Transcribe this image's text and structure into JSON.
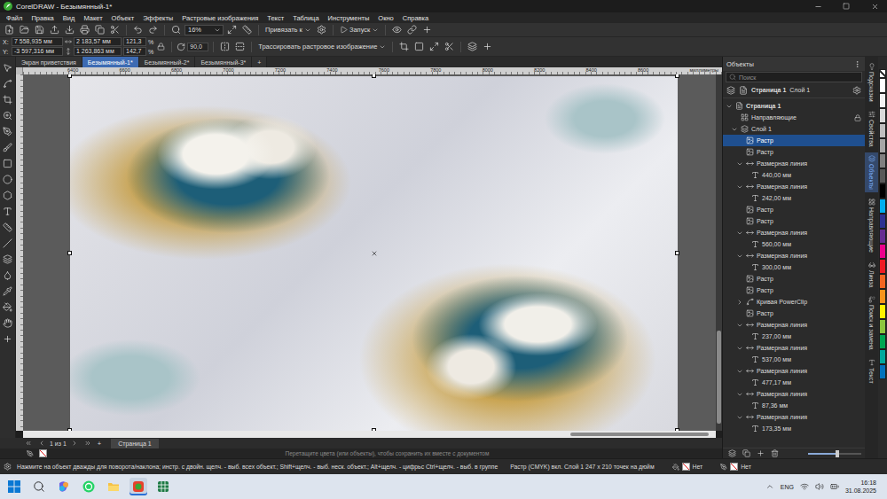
{
  "window": {
    "title": "CorelDRAW - Безымянный-1*"
  },
  "menu": [
    "Файл",
    "Правка",
    "Вид",
    "Макет",
    "Объект",
    "Эффекты",
    "Растровые изображения",
    "Текст",
    "Таблица",
    "Инструменты",
    "Окно",
    "Справка"
  ],
  "standard_toolbar": {
    "zoom": "16%",
    "snap": "Привязать к",
    "launch": "Запуск"
  },
  "property_bar": {
    "position": [
      {
        "label": "X:",
        "value": "7 558,935 мм"
      },
      {
        "label": "Y:",
        "value": "-3 597,316 мм"
      }
    ],
    "size": [
      "2 183,57 мм",
      "1 263,863 мм"
    ],
    "scale": [
      {
        "value": "121,3",
        "unit": "%"
      },
      {
        "value": "142,7",
        "unit": "%"
      }
    ],
    "rotation": "90,0",
    "trace": "Трассировать растровое изображение"
  },
  "document_tabs": [
    {
      "label": "Экран приветствия",
      "selected": false
    },
    {
      "label": "Безымянный-1*",
      "selected": true
    },
    {
      "label": "Безымянный-2*",
      "selected": false
    },
    {
      "label": "Безымянный-3*",
      "selected": false
    }
  ],
  "add_tab": "+",
  "ruler": {
    "labels": [
      "6400",
      "6600",
      "6800",
      "7000",
      "7200",
      "7400",
      "7600",
      "7800",
      "8000",
      "8200",
      "8400",
      "8600"
    ],
    "unit": "миллиметры"
  },
  "canvas": {
    "image_selected": true,
    "scroll_h": {
      "start": 0.79,
      "size": 0.2
    },
    "scroll_v": {
      "start": 0.72,
      "size": 0.26
    }
  },
  "page_nav": {
    "count": "1 из 1",
    "add_page": "+",
    "pages": [
      {
        "label": "Страница 1",
        "selected": true
      }
    ]
  },
  "hint": "Перетащите цвета (или объекты), чтобы сохранить их вместе с документом",
  "objects_docker": {
    "title": "Объекты",
    "search_placeholder": "Поиск",
    "page": "Страница 1",
    "layer": "Слой 1",
    "thumbnail_size": {
      "level": 0.55
    },
    "tree": [
      {
        "label": "Страница 1",
        "kind": "page",
        "depth": 0,
        "expandable": true,
        "expanded": true,
        "selected": false,
        "locked": false
      },
      {
        "label": "Направляющие",
        "kind": "guides",
        "depth": 1,
        "expandable": false,
        "expanded": false,
        "selected": false,
        "locked": true
      },
      {
        "label": "Слой 1",
        "kind": "layer",
        "depth": 1,
        "expandable": true,
        "expanded": true,
        "selected": false,
        "locked": false
      },
      {
        "label": "Растр",
        "kind": "raster",
        "depth": 2,
        "expandable": false,
        "expanded": false,
        "selected": true,
        "locked": false
      },
      {
        "label": "Растр",
        "kind": "raster",
        "depth": 2,
        "expandable": false,
        "expanded": false,
        "selected": false,
        "locked": false
      },
      {
        "label": "Размерная линия",
        "kind": "dimension",
        "depth": 2,
        "expandable": true,
        "expanded": true,
        "selected": false,
        "locked": false
      },
      {
        "label": "440,00 мм",
        "kind": "text",
        "depth": 3,
        "expandable": false,
        "expanded": false,
        "selected": false,
        "locked": false
      },
      {
        "label": "Размерная линия",
        "kind": "dimension",
        "depth": 2,
        "expandable": true,
        "expanded": true,
        "selected": false,
        "locked": false
      },
      {
        "label": "242,00 мм",
        "kind": "text",
        "depth": 3,
        "expandable": false,
        "expanded": false,
        "selected": false,
        "locked": false
      },
      {
        "label": "Растр",
        "kind": "raster",
        "depth": 2,
        "expandable": false,
        "expanded": false,
        "selected": false,
        "locked": false
      },
      {
        "label": "Растр",
        "kind": "raster",
        "depth": 2,
        "expandable": false,
        "expanded": false,
        "selected": false,
        "locked": false
      },
      {
        "label": "Размерная линия",
        "kind": "dimension",
        "depth": 2,
        "expandable": true,
        "expanded": true,
        "selected": false,
        "locked": false
      },
      {
        "label": "560,00 мм",
        "kind": "text",
        "depth": 3,
        "expandable": false,
        "expanded": false,
        "selected": false,
        "locked": false
      },
      {
        "label": "Размерная линия",
        "kind": "dimension",
        "depth": 2,
        "expandable": true,
        "expanded": true,
        "selected": false,
        "locked": false
      },
      {
        "label": "300,00 мм",
        "kind": "text",
        "depth": 3,
        "expandable": false,
        "expanded": false,
        "selected": false,
        "locked": false
      },
      {
        "label": "Растр",
        "kind": "raster",
        "depth": 2,
        "expandable": false,
        "expanded": false,
        "selected": false,
        "locked": false
      },
      {
        "label": "Растр",
        "kind": "raster",
        "depth": 2,
        "expandable": false,
        "expanded": false,
        "selected": false,
        "locked": false
      },
      {
        "label": "Кривая PowerClip",
        "kind": "powerclip",
        "depth": 2,
        "expandable": true,
        "expanded": false,
        "selected": false,
        "locked": false
      },
      {
        "label": "Растр",
        "kind": "raster",
        "depth": 2,
        "expandable": false,
        "expanded": false,
        "selected": false,
        "locked": false
      },
      {
        "label": "Размерная линия",
        "kind": "dimension",
        "depth": 2,
        "expandable": true,
        "expanded": true,
        "selected": false,
        "locked": false
      },
      {
        "label": "237,00 мм",
        "kind": "text",
        "depth": 3,
        "expandable": false,
        "expanded": false,
        "selected": false,
        "locked": false
      },
      {
        "label": "Размерная линия",
        "kind": "dimension",
        "depth": 2,
        "expandable": true,
        "expanded": true,
        "selected": false,
        "locked": false
      },
      {
        "label": "537,00 мм",
        "kind": "text",
        "depth": 3,
        "expandable": false,
        "expanded": false,
        "selected": false,
        "locked": false
      },
      {
        "label": "Размерная линия",
        "kind": "dimension",
        "depth": 2,
        "expandable": true,
        "expanded": true,
        "selected": false,
        "locked": false
      },
      {
        "label": "477,17 мм",
        "kind": "text",
        "depth": 3,
        "expandable": false,
        "expanded": false,
        "selected": false,
        "locked": false
      },
      {
        "label": "Размерная линия",
        "kind": "dimension",
        "depth": 2,
        "expandable": true,
        "expanded": true,
        "selected": false,
        "locked": false
      },
      {
        "label": "87,36 мм",
        "kind": "text",
        "depth": 3,
        "expandable": false,
        "expanded": false,
        "selected": false,
        "locked": false
      },
      {
        "label": "Размерная линия",
        "kind": "dimension",
        "depth": 2,
        "expandable": true,
        "expanded": true,
        "selected": false,
        "locked": false
      },
      {
        "label": "173,35 мм",
        "kind": "text",
        "depth": 3,
        "expandable": false,
        "expanded": false,
        "selected": false,
        "locked": false
      }
    ]
  },
  "side_tabs": [
    {
      "label": "Подсказки",
      "selected": false
    },
    {
      "label": "Свойства",
      "selected": false
    },
    {
      "label": "Объекты",
      "selected": true
    },
    {
      "label": "Направляющие",
      "selected": false
    },
    {
      "label": "Линза",
      "selected": false
    },
    {
      "label": "Поиск и замена",
      "selected": false
    },
    {
      "label": "Текст",
      "selected": false
    }
  ],
  "palette": [
    {
      "color": "#ffffff"
    },
    {
      "color": "#f2f2f2"
    },
    {
      "color": "#d9d9d9"
    },
    {
      "color": "#bfbfbf"
    },
    {
      "color": "#a6a6a6"
    },
    {
      "color": "#808080"
    },
    {
      "color": "#595959"
    },
    {
      "color": "#000000"
    },
    {
      "color": "#00aeef"
    },
    {
      "color": "#2e3192"
    },
    {
      "color": "#662d91"
    },
    {
      "color": "#ec008c"
    },
    {
      "color": "#ed1c24"
    },
    {
      "color": "#f26522"
    },
    {
      "color": "#f7941d"
    },
    {
      "color": "#fff200"
    },
    {
      "color": "#8dc63f"
    },
    {
      "color": "#00a651"
    },
    {
      "color": "#00a99d"
    },
    {
      "color": "#0072bc"
    }
  ],
  "status_bar": {
    "hint": "Нажмите на объект дважды для поворота/наклона; инстр. с двойн. щелч. - выб. всех объект.; Shift+щелч. - выб. неск. объект.; Alt+щелч. - цифрьс Ctrl+щелч. - выб. в группе",
    "object": "Растр (CMYK) вкл. Слой 1 247 x 210 точек на дюйм",
    "fill": "Нет",
    "outline": "Нет"
  },
  "taskbar": {
    "language": "ENG",
    "time": "16:18",
    "date": "31.08.2025"
  }
}
